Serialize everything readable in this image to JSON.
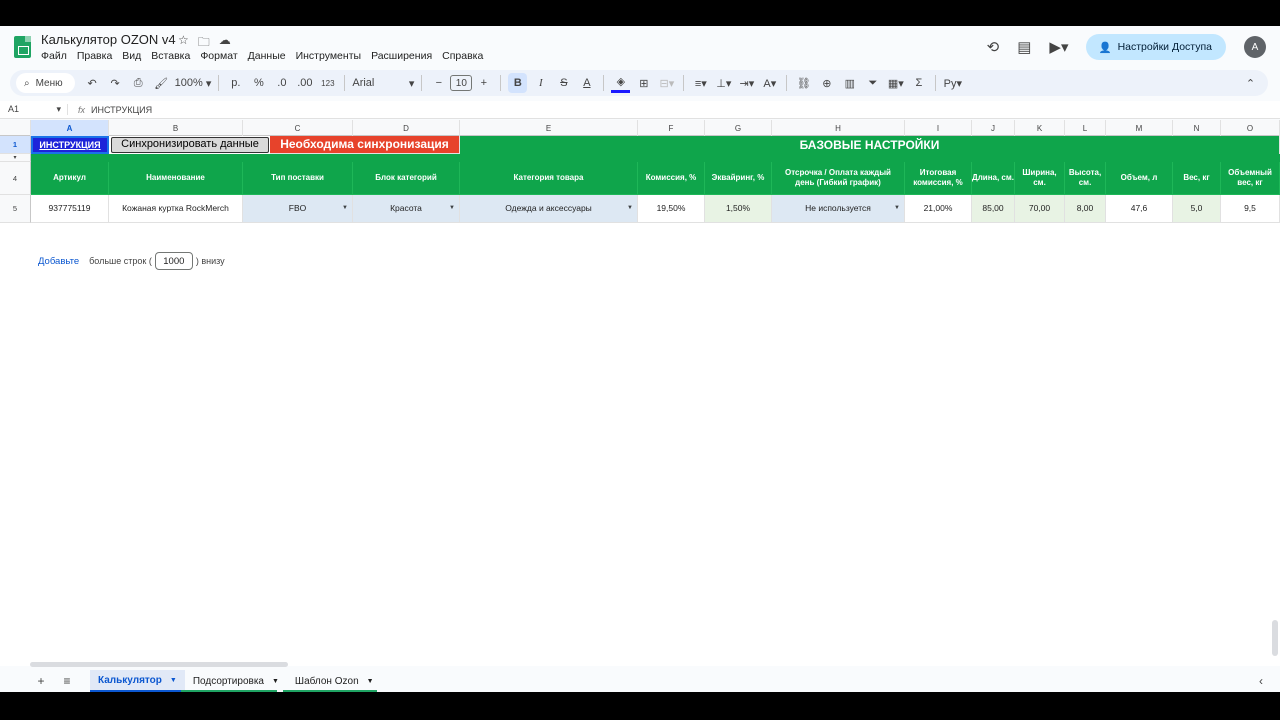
{
  "doc": {
    "title": "Калькулятор OZON v4"
  },
  "menu": [
    "Файл",
    "Правка",
    "Вид",
    "Вставка",
    "Формат",
    "Данные",
    "Инструменты",
    "Расширения",
    "Справка"
  ],
  "header": {
    "share_label": "Настройки Доступа",
    "avatar_letter": "A"
  },
  "toolbar": {
    "search_label": "Меню",
    "zoom": "100%",
    "currency": "р.",
    "percent": "%",
    "dec_minus": ".0",
    "dec_plus": ".00",
    "number_format": "123",
    "font": "Arial",
    "font_size": "10",
    "bold": "B",
    "italic": "I",
    "text_color": "A"
  },
  "formula_bar": {
    "cell_ref": "A1",
    "fx": "fx",
    "value": "ИНСТРУКЦИЯ"
  },
  "columns": [
    "A",
    "B",
    "C",
    "D",
    "E",
    "F",
    "G",
    "H",
    "I",
    "J",
    "K",
    "L",
    "M",
    "N",
    "O"
  ],
  "rows": {
    "r1": "1",
    "r4": "4",
    "r5": "5"
  },
  "row1": {
    "instruction": "ИНСТРУКЦИЯ",
    "sync_button": "Синхронизировать данные",
    "need_sync": "Необходима синхронизация",
    "base_settings": "БАЗОВЫЕ НАСТРОЙКИ"
  },
  "table": {
    "headers": [
      "Артикул",
      "Наименование",
      "Тип поставки",
      "Блок категорий",
      "Категория товара",
      "Комиссия, %",
      "Эквайринг, %",
      "Отсрочка / Оплата каждый день (Гибкий график)",
      "Итоговая комиссия, %",
      "Длина, см.",
      "Ширина, см.",
      "Высота, см.",
      "Объем, л",
      "Вес, кг",
      "Объемный вес, кг"
    ],
    "row5": [
      "937775119",
      "Кожаная куртка RockMerch",
      "FBO",
      "Красота",
      "Одежда и аксессуары",
      "19,50%",
      "1,50%",
      "Не используется",
      "21,00%",
      "85,00",
      "70,00",
      "8,00",
      "47,6",
      "5,0",
      "9,5"
    ]
  },
  "add_rows": {
    "link": "Добавьте",
    "before": "больше строк (",
    "count": "1000",
    "after": ") внизу"
  },
  "sheets": [
    "Калькулятор",
    "Подсортировка",
    "Шаблон Ozon"
  ]
}
